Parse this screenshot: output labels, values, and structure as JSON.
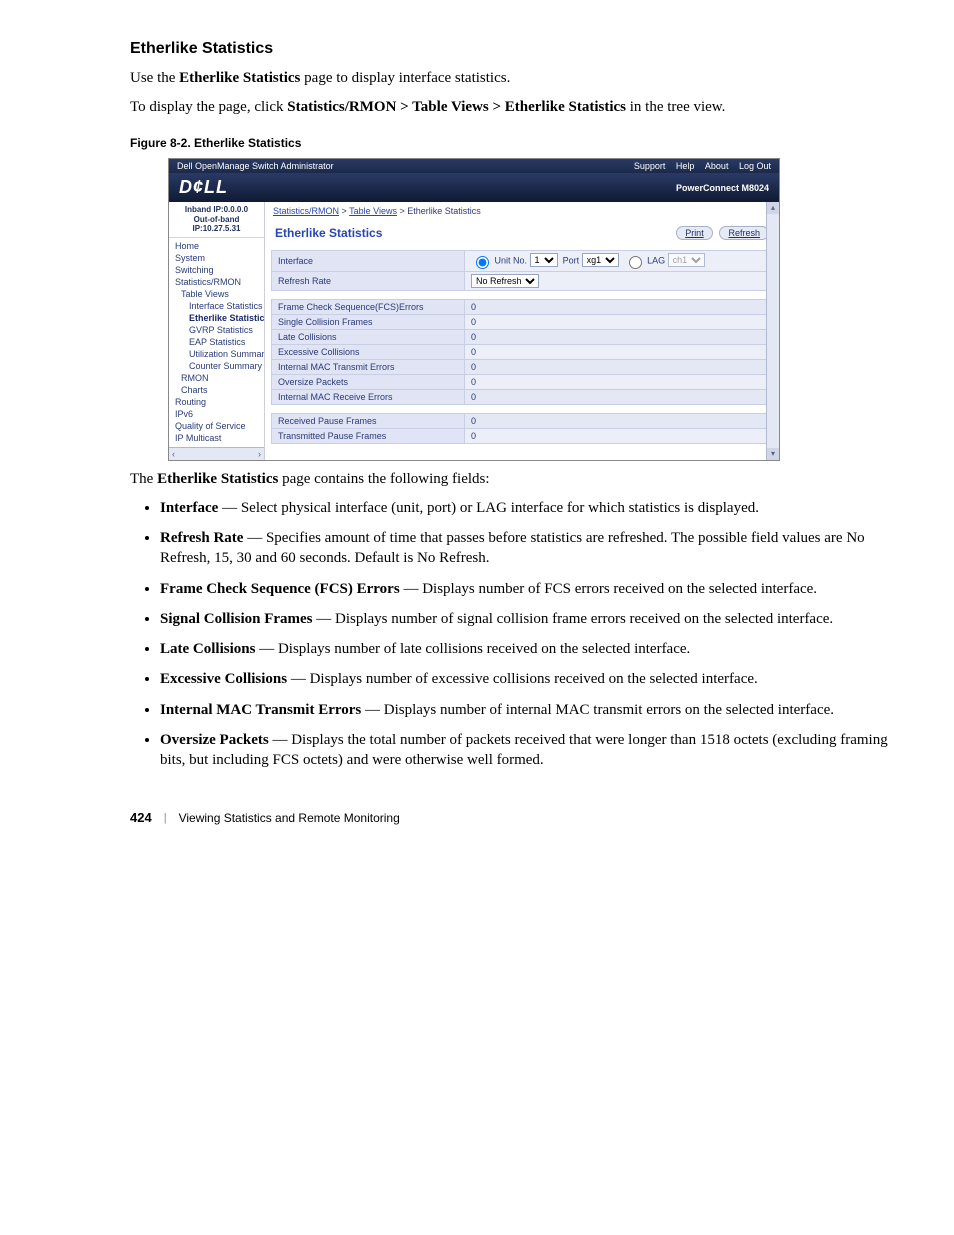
{
  "section_title": "Etherlike Statistics",
  "intro1_a": "Use the ",
  "intro1_b": "Etherlike Statistics",
  "intro1_c": " page to display interface statistics.",
  "intro2_a": "To display the page, click ",
  "intro2_b": "Statistics/RMON > Table Views > Etherlike Statistics",
  "intro2_c": " in the tree view.",
  "figcap": "Figure 8-2.    Etherlike Statistics",
  "screenshot": {
    "topbar_title": "Dell OpenManage Switch Administrator",
    "topbar_links": [
      "Support",
      "Help",
      "About",
      "Log Out"
    ],
    "logo_text": "D¢LL",
    "product": "PowerConnect M8024",
    "ip1": "Inband IP:0.0.0.0",
    "ip2": "Out-of-band IP:10.27.5.31",
    "tree": [
      "Home",
      "System",
      "Switching",
      "Statistics/RMON",
      "  Table Views",
      "    Interface Statistics",
      "    Etherlike Statistics",
      "    GVRP Statistics",
      "    EAP Statistics",
      "    Utilization Summary",
      "    Counter Summary",
      "  RMON",
      "  Charts",
      "Routing",
      "IPv6",
      "Quality of Service",
      "IP Multicast"
    ],
    "crumb_a": "Statistics/RMON",
    "crumb_b": "Table Views",
    "crumb_c": "Etherlike Statistics",
    "panel_title": "Etherlike Statistics",
    "btn_print": "Print",
    "btn_refresh": "Refresh",
    "row_iface": "Interface",
    "iface_unitno": "Unit No.",
    "iface_unit_val": "1",
    "iface_port": "Port",
    "iface_port_val": "xg1",
    "iface_lag": "LAG",
    "iface_lag_val": "ch1",
    "row_refresh": "Refresh Rate",
    "refresh_val": "No Refresh",
    "stats": [
      {
        "label": "Frame Check Sequence(FCS)Errors",
        "value": "0"
      },
      {
        "label": "Single Collision Frames",
        "value": "0"
      },
      {
        "label": "Late Collisions",
        "value": "0"
      },
      {
        "label": "Excessive Collisions",
        "value": "0"
      },
      {
        "label": "Internal MAC Transmit Errors",
        "value": "0"
      },
      {
        "label": "Oversize Packets",
        "value": "0"
      },
      {
        "label": "Internal MAC Receive Errors",
        "value": "0"
      }
    ],
    "pause": [
      {
        "label": "Received Pause Frames",
        "value": "0"
      },
      {
        "label": "Transmitted Pause Frames",
        "value": "0"
      }
    ]
  },
  "after_fig": "The ",
  "after_fig_b": "Etherlike Statistics",
  "after_fig_c": " page contains the following fields:",
  "bullets": [
    {
      "b": "Interface",
      "t": " — Select physical interface (unit, port) or LAG interface for which statistics is displayed."
    },
    {
      "b": "Refresh Rate",
      "t": " — Specifies amount of time that passes before statistics are refreshed. The possible field values are No Refresh, 15, 30 and 60 seconds. Default is No Refresh."
    },
    {
      "b": "Frame Check Sequence (FCS) Errors",
      "t": " — Displays number of FCS errors received on the selected interface."
    },
    {
      "b": "Signal Collision Frames",
      "t": " — Displays number of signal collision frame errors received on the selected interface."
    },
    {
      "b": "Late Collisions",
      "t": " — Displays number of late collisions received on the selected interface."
    },
    {
      "b": "Excessive Collisions",
      "t": " — Displays number of excessive collisions received on the selected interface."
    },
    {
      "b": "Internal MAC Transmit Errors",
      "t": " — Displays number of internal MAC transmit errors on the selected interface."
    },
    {
      "b": "Oversize Packets",
      "t": " — Displays the total number of packets received that were longer than 1518 octets (excluding framing bits, but including FCS octets) and were otherwise well formed."
    }
  ],
  "footer_page": "424",
  "footer_text": "Viewing Statistics and Remote Monitoring"
}
